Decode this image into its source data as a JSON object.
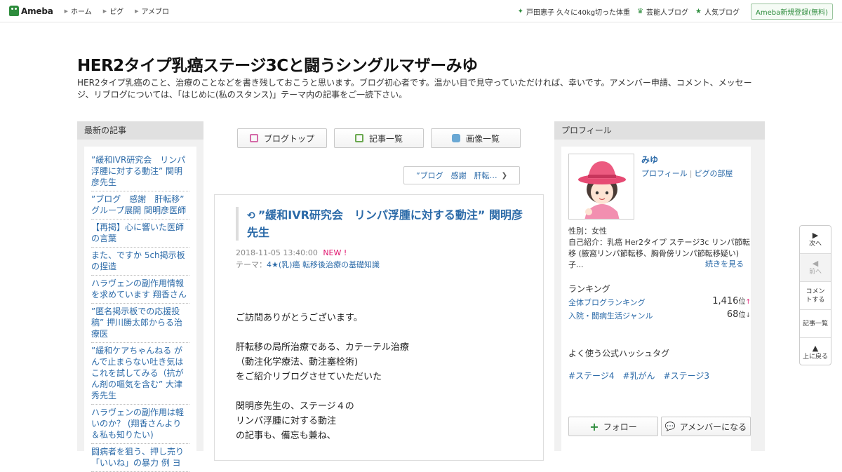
{
  "topbar": {
    "logo": "Ameba",
    "nav": [
      "ホーム",
      "ピグ",
      "アメブロ"
    ],
    "right_items": [
      {
        "icon": "sparkle-icon",
        "label": "戸田恵子 久々に40kg切った体重"
      },
      {
        "icon": "crown-icon",
        "label": "芸能人ブログ"
      },
      {
        "icon": "star-icon",
        "label": "人気ブログ"
      }
    ],
    "register": "Ameba新規登録(無料)"
  },
  "blog": {
    "title": "HER2タイプ乳癌ステージ3Cと闘うシングルマザーみゆ",
    "description": "HER2タイプ乳癌のこと、治療のことなどを書き残しておこうと思います。ブログ初心者です。温かい目で見守っていただければ、幸いです。アメンバー申請、コメント、メッセージ、リブログについては、「はじめに(私のスタンス)」テーマ内の記事をご一読下さい。"
  },
  "left": {
    "heading": "最新の記事",
    "items": [
      "”緩和IVR研究会　リンパ浮腫に対する動注” 関明彦先生",
      "”ブログ　感謝　肝転移” グループ展開 関明彦医師",
      "【再掲】心に響いた医師の言葉",
      "また、ですか 5ch掲示板の捏造",
      "ハラヴェンの副作用情報を求めています 翔香さん",
      "”匿名掲示板での応援投稿” 押川勝太郎からる治療医",
      "”緩和ケアちゃんねる がんで止まらない吐き気はこれを試してみる（抗がん剤の嘔気を含む” 大津秀先生",
      "ハラヴェンの副作用は軽いのか？ (翔香さんより＆私も知りたい)",
      "闘病者を狙う、押し売り「いいね」の暴力 例 ヨ"
    ]
  },
  "center": {
    "buttons": [
      {
        "icon": "document-icon",
        "label": "ブログトップ",
        "color": "#d46aa8"
      },
      {
        "icon": "list-icon",
        "label": "記事一覧",
        "color": "#6aa84f"
      },
      {
        "icon": "camera-icon",
        "label": "画像一覧",
        "color": "#6aa8d4"
      }
    ],
    "next_link": "”ブログ　感謝　肝転…"
  },
  "article": {
    "title": "”緩和IVR研究会　リンパ浮腫に対する動注” 関明彦先生",
    "date": "2018-11-05 13:40:00",
    "new_badge": "NEW !",
    "theme_label": "テーマ：",
    "theme": "4★(乳)癌 転移後治療の基礎知識",
    "body": [
      "",
      "",
      "ご訪問ありがとうございます。",
      "",
      "肝転移の局所治療である、カテーテル治療",
      "（動注化学療法、動注塞栓術)",
      "をご紹介リブログさせていただいた",
      "",
      "関明彦先生の、ステージ４の",
      "リンパ浮腫に対する動注",
      "の記事も、備忘も兼ね、"
    ]
  },
  "right": {
    "heading": "プロフィール",
    "name": "みゆ",
    "link_profile": "プロフィール",
    "link_pig": "ピグの部屋",
    "gender": "性別：女性",
    "intro": "自己紹介：乳癌 Her2タイプ ステージ3c リンパ節転移 (腋窩リンパ節転移、胸骨傍リンパ節転移疑い) 子...",
    "more": "続きを見る",
    "ranking_heading": "ランキング",
    "rankings": [
      {
        "label": "全体ブログランキング",
        "value": "1,416",
        "unit": "位",
        "trend": "↑"
      },
      {
        "label": "入院・闘病生活ジャンル",
        "value": "68",
        "unit": "位",
        "trend": "↓"
      }
    ],
    "hashtag_heading": "よく使う公式ハッシュタグ",
    "hashtags": [
      "#ステージ4",
      "#乳がん",
      "#ステージ3"
    ],
    "follow": "フォロー",
    "amember": "アメンバーになる"
  },
  "float_nav": [
    {
      "icon": "triangle-right-icon",
      "label": "次へ",
      "enabled": true
    },
    {
      "icon": "triangle-left-icon",
      "label": "前へ",
      "enabled": false
    },
    {
      "icon": "",
      "label": "コメントする",
      "enabled": true
    },
    {
      "icon": "",
      "label": "記事一覧",
      "enabled": true
    },
    {
      "icon": "triangle-up-icon",
      "label": "上に戻る",
      "enabled": true
    }
  ]
}
